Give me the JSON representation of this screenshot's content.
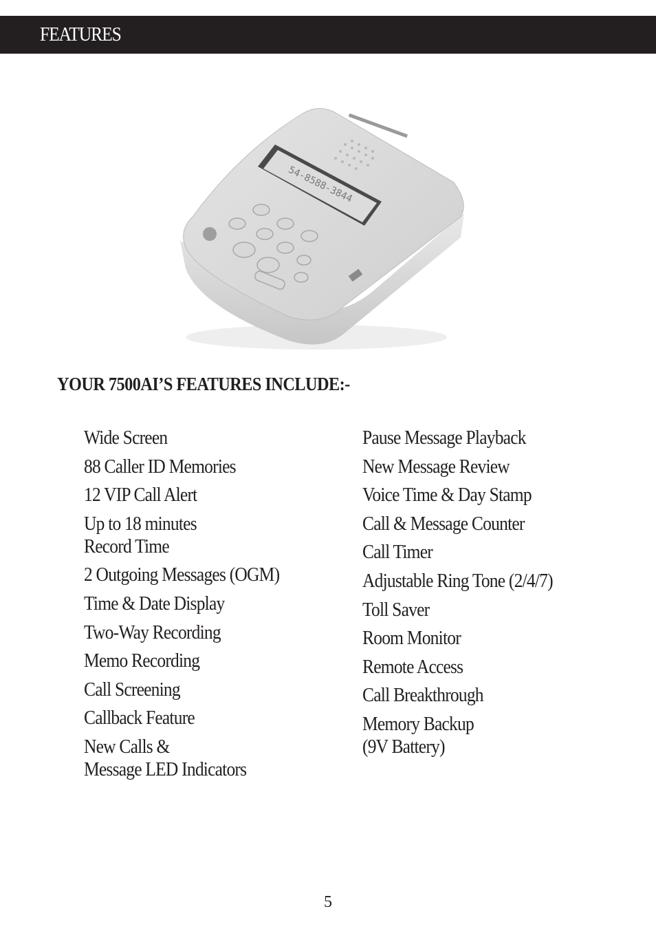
{
  "header": {
    "title": "FEATURES",
    "background_color": "#231f20",
    "text_color": "#ffffff"
  },
  "product_image": {
    "alt": "7500AI caller ID answering machine",
    "display_text": "54-8588-3844"
  },
  "section": {
    "heading": "YOUR 7500AI’S FEATURES INCLUDE:-"
  },
  "features": {
    "left": [
      {
        "label": "Wide Screen"
      },
      {
        "label": "88 Caller ID Memories"
      },
      {
        "label": "12 VIP Call Alert"
      },
      {
        "label": "Up to 18 minutes\nRecord Time"
      },
      {
        "label": "2 Outgoing Messages (OGM)"
      },
      {
        "label": "Time & Date Display"
      },
      {
        "label": "Two-Way Recording"
      },
      {
        "label": "Memo Recording"
      },
      {
        "label": "Call Screening"
      },
      {
        "label": "Callback Feature"
      },
      {
        "label": "New Calls &\nMessage LED Indicators"
      }
    ],
    "right": [
      {
        "label": "Pause Message Playback"
      },
      {
        "label": "New Message Review"
      },
      {
        "label": "Voice Time & Day Stamp"
      },
      {
        "label": "Call & Message Counter"
      },
      {
        "label": "Call Timer"
      },
      {
        "label": "Adjustable Ring Tone (2/4/7)"
      },
      {
        "label": "Toll Saver"
      },
      {
        "label": "Room Monitor"
      },
      {
        "label": "Remote Access"
      },
      {
        "label": "Call Breakthrough"
      },
      {
        "label": "Memory Backup\n(9V Battery)"
      }
    ]
  },
  "footer": {
    "page_number": "5"
  }
}
